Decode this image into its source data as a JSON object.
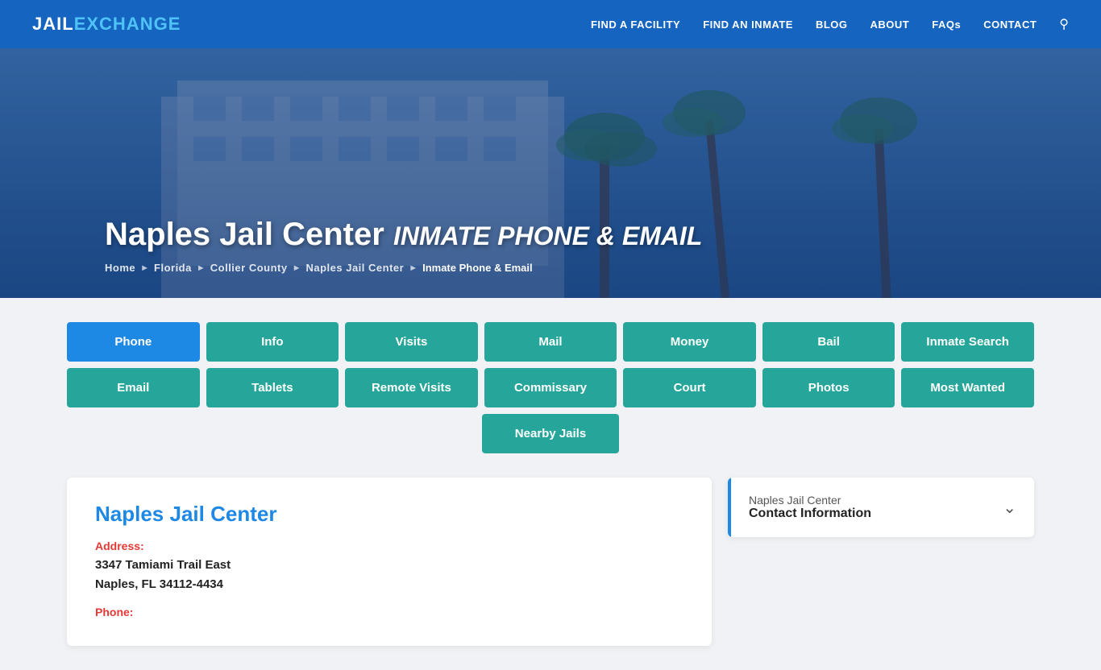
{
  "header": {
    "logo_jail": "JAIL",
    "logo_exchange": "EXCHANGE",
    "nav": [
      {
        "label": "FIND A FACILITY",
        "id": "find-facility"
      },
      {
        "label": "FIND AN INMATE",
        "id": "find-inmate"
      },
      {
        "label": "BLOG",
        "id": "blog"
      },
      {
        "label": "ABOUT",
        "id": "about"
      },
      {
        "label": "FAQs",
        "id": "faqs"
      },
      {
        "label": "CONTACT",
        "id": "contact"
      }
    ]
  },
  "hero": {
    "title_main": "Naples Jail Center",
    "title_italic": "INMATE PHONE & EMAIL",
    "breadcrumb": [
      {
        "label": "Home",
        "href": "#"
      },
      {
        "label": "Florida",
        "href": "#"
      },
      {
        "label": "Collier County",
        "href": "#"
      },
      {
        "label": "Naples Jail Center",
        "href": "#"
      },
      {
        "label": "Inmate Phone & Email",
        "current": true
      }
    ]
  },
  "buttons": {
    "row1": [
      {
        "label": "Phone",
        "active": true
      },
      {
        "label": "Info",
        "active": false
      },
      {
        "label": "Visits",
        "active": false
      },
      {
        "label": "Mail",
        "active": false
      },
      {
        "label": "Money",
        "active": false
      },
      {
        "label": "Bail",
        "active": false
      },
      {
        "label": "Inmate Search",
        "active": false
      }
    ],
    "row2": [
      {
        "label": "Email",
        "active": false
      },
      {
        "label": "Tablets",
        "active": false
      },
      {
        "label": "Remote Visits",
        "active": false
      },
      {
        "label": "Commissary",
        "active": false
      },
      {
        "label": "Court",
        "active": false
      },
      {
        "label": "Photos",
        "active": false
      },
      {
        "label": "Most Wanted",
        "active": false
      }
    ],
    "row3": [
      {
        "label": "Nearby Jails",
        "active": false
      }
    ]
  },
  "info_card": {
    "title": "Naples Jail Center",
    "address_label": "Address:",
    "address_line1": "3347 Tamiami Trail East",
    "address_line2": "Naples, FL 34112-4434",
    "phone_label": "Phone:"
  },
  "sidebar": {
    "subtitle": "Naples Jail Center",
    "title": "Contact Information"
  }
}
